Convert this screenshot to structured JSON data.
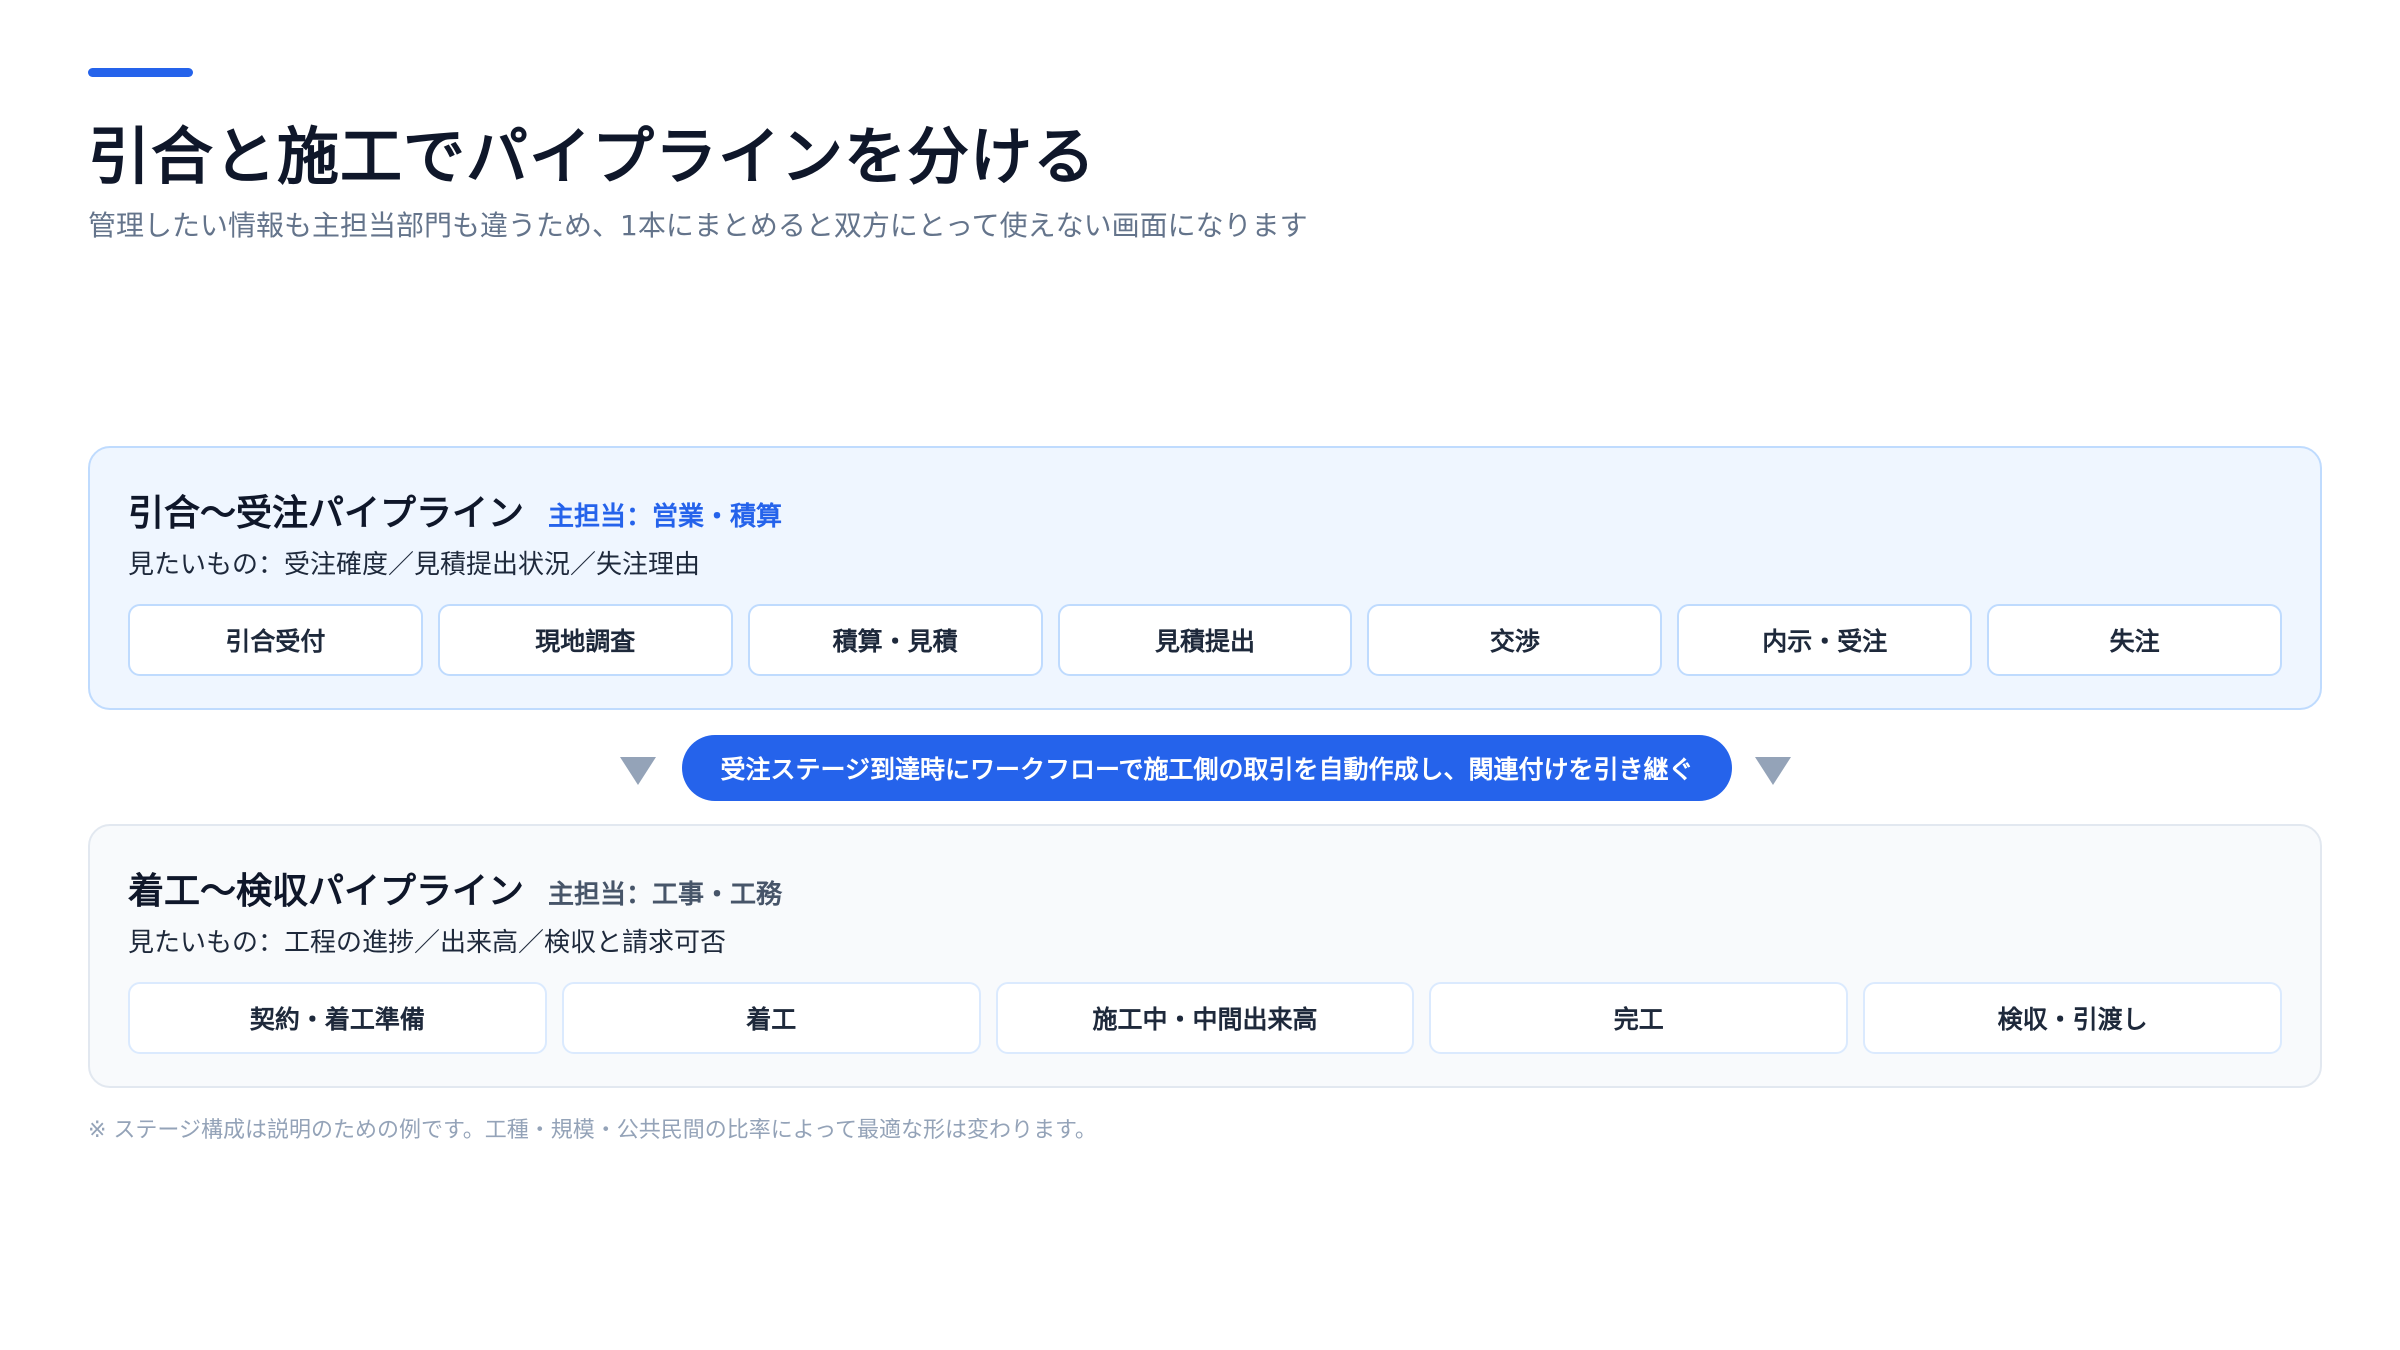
{
  "header": {
    "title": "引合と施工でパイプラインを分ける",
    "subtitle": "管理したい情報も主担当部門も違うため、1本にまとめると双方にとって使えない画面になります"
  },
  "pipelines": [
    {
      "title": "引合〜受注パイプライン",
      "owner": "主担当：営業・積算",
      "note": "見たいもの：受注確度／見積提出状況／失注理由",
      "stages": [
        "引合受付",
        "現地調査",
        "積算・見積",
        "見積提出",
        "交渉",
        "内示・受注",
        "失注"
      ]
    },
    {
      "title": "着工〜検収パイプライン",
      "owner": "主担当：工事・工務",
      "note": "見たいもの：工程の進捗／出来高／検収と請求可否",
      "stages": [
        "契約・着工準備",
        "着工",
        "施工中・中間出来高",
        "完工",
        "検収・引渡し"
      ]
    }
  ],
  "connector": {
    "label": "受注ステージ到達時にワークフローで施工側の取引を自動作成し、関連付けを引き継ぐ"
  },
  "footnote": "※ ステージ構成は説明のための例です。工種・規模・公共民間の比率によって最適な形は変わります。",
  "colors": {
    "accent": "#2563eb",
    "title": "#0f172a",
    "muted": "#64748b",
    "top_panel_bg": "#eff6ff",
    "bottom_panel_bg": "#f8fafc"
  }
}
